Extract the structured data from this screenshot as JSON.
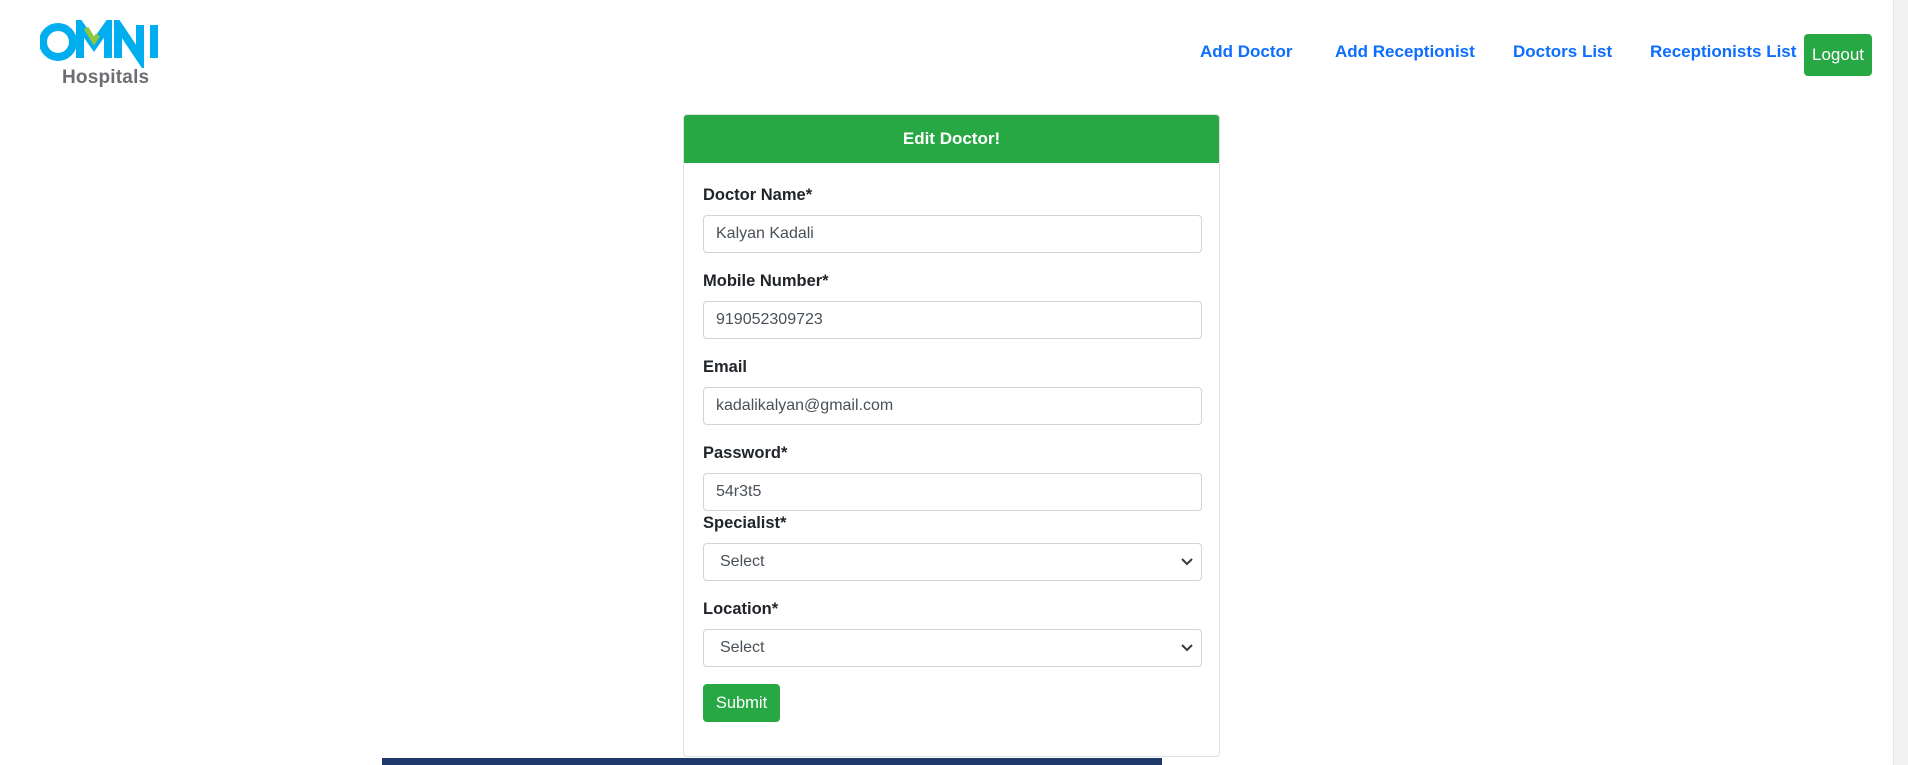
{
  "brand": {
    "logo_text": "OMNI",
    "logo_subtitle": "Hospitals",
    "colors": {
      "primary": "#00aeef",
      "accent": "#8dc63f",
      "subtitle": "#6d6e71"
    }
  },
  "nav": {
    "links": [
      "Add Doctor",
      "Add Receptionist",
      "Doctors List",
      "Receptionists List"
    ],
    "logout_label": "Logout"
  },
  "form": {
    "title": "Edit Doctor!",
    "fields": {
      "doctor_name": {
        "label": "Doctor Name*",
        "value": "Kalyan Kadali"
      },
      "mobile": {
        "label": "Mobile Number*",
        "value": "919052309723"
      },
      "email": {
        "label": "Email",
        "value": "kadalikalyan@gmail.com"
      },
      "password": {
        "label": "Password*",
        "value": "54r3t5"
      },
      "specialist": {
        "label": "Specialist*",
        "selected": "Select"
      },
      "location": {
        "label": "Location*",
        "selected": "Select"
      }
    },
    "submit_label": "Submit"
  },
  "theme": {
    "success": "#28a745",
    "link": "#0d6efd",
    "footer": "#1f3a6a"
  },
  "icons": [
    "chevron-down-icon"
  ]
}
